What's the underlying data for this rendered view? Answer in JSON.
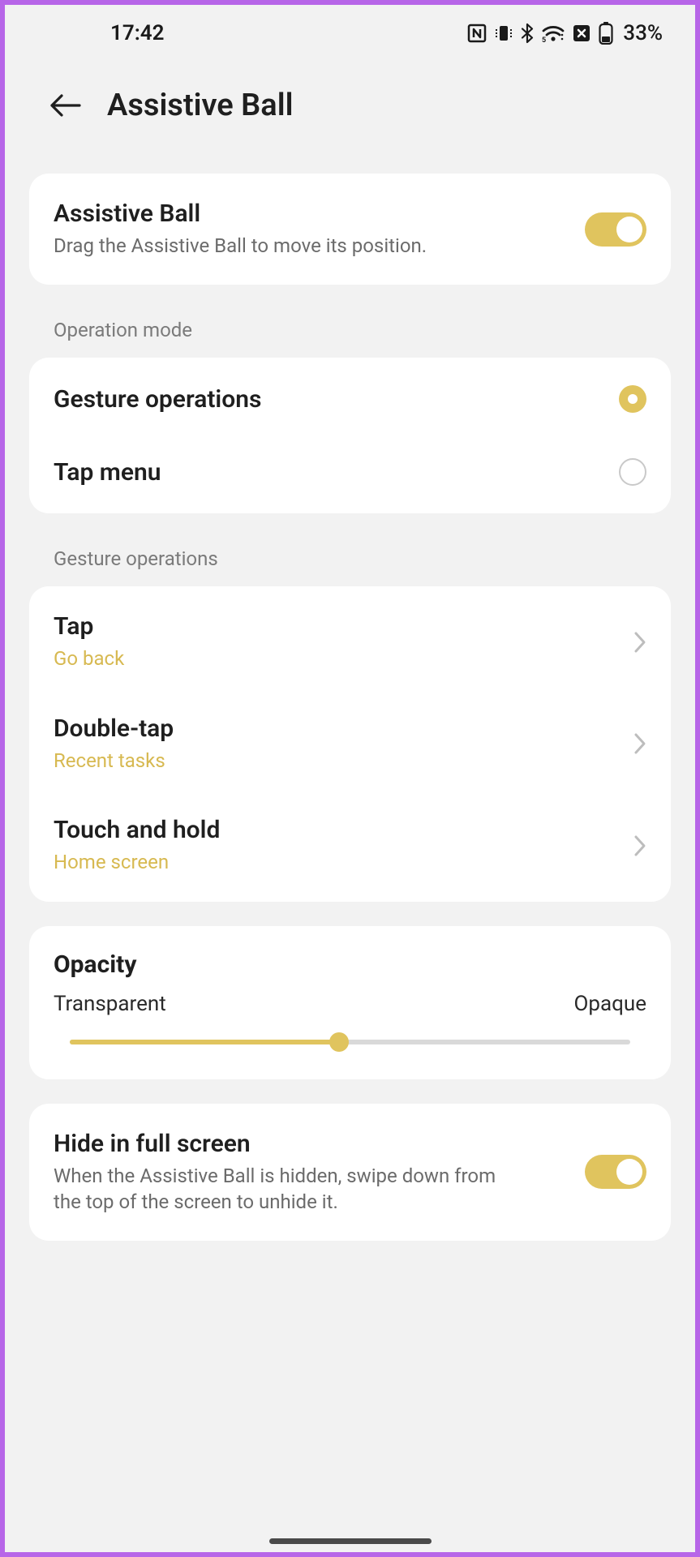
{
  "status": {
    "time": "17:42",
    "battery": "33%"
  },
  "header": {
    "title": "Assistive Ball"
  },
  "main_toggle": {
    "title": "Assistive Ball",
    "subtitle": "Drag the Assistive Ball to move its position.",
    "enabled": true
  },
  "operation_mode": {
    "section_label": "Operation mode",
    "options": [
      {
        "label": "Gesture operations",
        "selected": true
      },
      {
        "label": "Tap menu",
        "selected": false
      }
    ]
  },
  "gesture_operations": {
    "section_label": "Gesture operations",
    "items": [
      {
        "title": "Tap",
        "value": "Go back"
      },
      {
        "title": "Double-tap",
        "value": "Recent tasks"
      },
      {
        "title": "Touch and hold",
        "value": "Home screen"
      }
    ]
  },
  "opacity": {
    "title": "Opacity",
    "min_label": "Transparent",
    "max_label": "Opaque",
    "percent": 48
  },
  "hide_fullscreen": {
    "title": "Hide in full screen",
    "subtitle": "When the Assistive Ball is hidden, swipe down from the top of the screen to unhide it.",
    "enabled": true
  }
}
